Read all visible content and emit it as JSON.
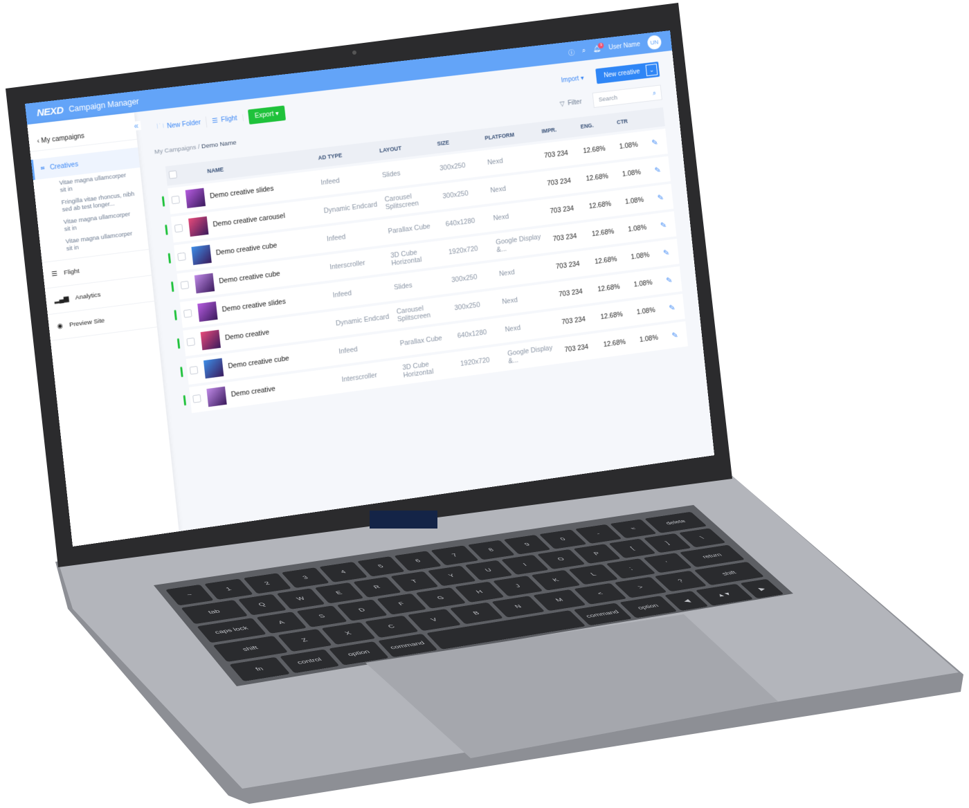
{
  "colors": {
    "accent": "#63a4f8",
    "primary_button": "#2f86f6",
    "export": "#1fc23b",
    "status": "#1fc23b"
  },
  "header": {
    "logo": "NEXD",
    "title": "Campaign Manager",
    "user_name": "User Name",
    "avatar": "UN",
    "notifications": "3",
    "icons": [
      "info-icon",
      "search-icon",
      "bell-icon"
    ]
  },
  "sidebar": {
    "back": "My campaigns",
    "active": "Creatives",
    "sub_items": [
      "Vitae magna ullamcorper sit in",
      "Fringilla vitae rhoncus, nibh sed ab test longer...",
      "Vitae magna ullamcorper sit in",
      "Vitae magna ullamcorper sit in"
    ],
    "items": [
      {
        "label": "Flight",
        "icon": "sliders-icon"
      },
      {
        "label": "Analytics",
        "icon": "bar-chart-icon"
      },
      {
        "label": "Preview Site",
        "icon": "eye-icon"
      }
    ]
  },
  "toolbar": {
    "new_folder": "New Folder",
    "flight": "Flight",
    "export": "Export",
    "import": "Import",
    "new_creative": "New creative",
    "filter": "Filter",
    "search_placeholder": "Search"
  },
  "breadcrumb": {
    "root": "My Campaigns",
    "sep": "/",
    "current": "Demo Name"
  },
  "table": {
    "columns": [
      "NAME",
      "AD TYPE",
      "LAYOUT",
      "SIZE",
      "PLATFORM",
      "IMPR.",
      "ENG.",
      "CTR"
    ],
    "rows": [
      {
        "name": "Demo creative slides",
        "ad_type": "Infeed",
        "layout": "Slides",
        "size": "300x250",
        "platform": "Nexd",
        "impr": "703 234",
        "eng": "12.68%",
        "ctr": "1.08%",
        "thumb": "#b65ce0"
      },
      {
        "name": "Demo creative carousel",
        "ad_type": "Dynamic Endcard",
        "layout": "Carousel Splitscreen",
        "size": "300x250",
        "platform": "Nexd",
        "impr": "703 234",
        "eng": "12.68%",
        "ctr": "1.08%",
        "thumb": "#e84a7a"
      },
      {
        "name": "Demo creative cube",
        "ad_type": "Infeed",
        "layout": "Parallax Cube",
        "size": "640x1280",
        "platform": "Nexd",
        "impr": "703 234",
        "eng": "12.68%",
        "ctr": "1.08%",
        "thumb": "#3d8ee8"
      },
      {
        "name": "Demo creative cube",
        "ad_type": "Interscroller",
        "layout": "3D Cube Horizontal",
        "size": "1920x720",
        "platform": "Google Display &...",
        "impr": "703 234",
        "eng": "12.68%",
        "ctr": "1.08%",
        "thumb": "#c08ae8"
      },
      {
        "name": "Demo creative slides",
        "ad_type": "Infeed",
        "layout": "Slides",
        "size": "300x250",
        "platform": "Nexd",
        "impr": "703 234",
        "eng": "12.68%",
        "ctr": "1.08%",
        "thumb": "#b65ce0"
      },
      {
        "name": "Demo creative",
        "ad_type": "Dynamic Endcard",
        "layout": "Carousel Splitscreen",
        "size": "300x250",
        "platform": "Nexd",
        "impr": "703 234",
        "eng": "12.68%",
        "ctr": "1.08%",
        "thumb": "#e84a7a"
      },
      {
        "name": "Demo creative cube",
        "ad_type": "Infeed",
        "layout": "Parallax Cube",
        "size": "640x1280",
        "platform": "Nexd",
        "impr": "703 234",
        "eng": "12.68%",
        "ctr": "1.08%",
        "thumb": "#3d8ee8"
      },
      {
        "name": "Demo creative",
        "ad_type": "Interscroller",
        "layout": "3D Cube Horizontal",
        "size": "1920x720",
        "platform": "Google Display &...",
        "impr": "703 234",
        "eng": "12.68%",
        "ctr": "1.08%",
        "thumb": "#c08ae8"
      }
    ]
  },
  "keyboard": [
    [
      "~",
      "1",
      "2",
      "3",
      "4",
      "5",
      "6",
      "7",
      "8",
      "9",
      "0",
      "-",
      "=",
      "delete"
    ],
    [
      "tab",
      "Q",
      "W",
      "E",
      "R",
      "T",
      "Y",
      "U",
      "I",
      "O",
      "P",
      "[",
      "]",
      "\\"
    ],
    [
      "caps lock",
      "A",
      "S",
      "D",
      "F",
      "G",
      "H",
      "J",
      "K",
      "L",
      ";",
      "'",
      "return"
    ],
    [
      "shift",
      "Z",
      "X",
      "C",
      "V",
      "B",
      "N",
      "M",
      "<",
      ">",
      "?",
      "shift"
    ],
    [
      "fn",
      "control",
      "option",
      "command",
      "",
      "command",
      "option",
      "◀",
      "▲▼",
      "▶"
    ]
  ]
}
